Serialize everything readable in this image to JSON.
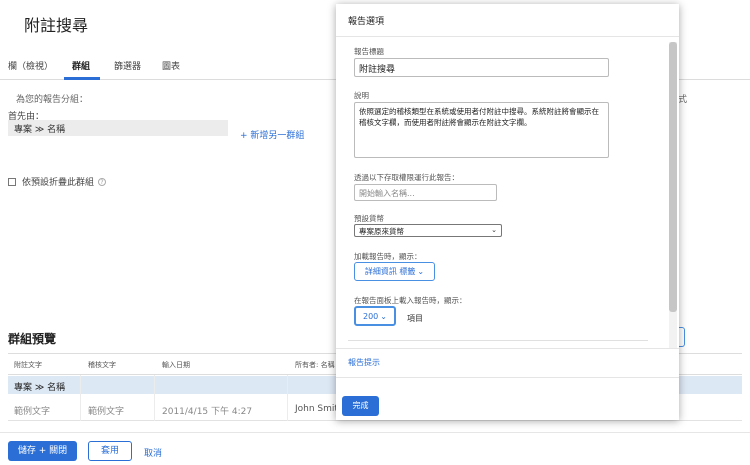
{
  "page": {
    "title": "附註搜尋",
    "tabs": [
      "欄（檢視）",
      "群組",
      "篩選器",
      "圖表"
    ],
    "active_tab": "群組",
    "group_label": "為您的報告分組：",
    "first_by_label": "首先由：",
    "group_field_value": "專案 ≫ 名稱",
    "add_group": "+ 新增另一群組",
    "collapse_label": "依預設折疊此群組",
    "right_clip": "式"
  },
  "preview": {
    "title": "群組預覽",
    "columns": [
      "附註文字",
      "稽核文字",
      "輸入日期",
      "所有者: 名稱"
    ],
    "group_row": "專案 ≫ 名稱",
    "row": [
      "範例文字",
      "範例文字",
      "2011/4/15 下午 4:27",
      "John Smith"
    ]
  },
  "footer": {
    "save": "儲存 + 關閉",
    "apply": "套用",
    "cancel": "取消"
  },
  "modal": {
    "title": "報告選項",
    "report_title_label": "報告標題",
    "report_title_value": "附註搜尋",
    "description_label": "說明",
    "description_value": "依照選定的稽核類型在系統或使用者付附註中搜尋。系統附註將會顯示在稽核文字欄，而使用者附註將會顯示在附註文字欄。",
    "access_label": "透過以下存取權限運行此報告：",
    "access_placeholder": "開始輸入名稱...",
    "currency_label": "預設貨幣",
    "currency_value": "專案原來貨幣",
    "load_label": "加載報告時，顯示：",
    "load_value": "詳細資訊 標籤",
    "dashboard_label": "在報告面板上載入報告時，顯示：",
    "dashboard_value": "200",
    "items_label": "項目",
    "tips": "報告提示",
    "done": "完成"
  },
  "colors": {
    "accent": "#2b6fd6",
    "group_row_bg": "#dde8f5"
  }
}
